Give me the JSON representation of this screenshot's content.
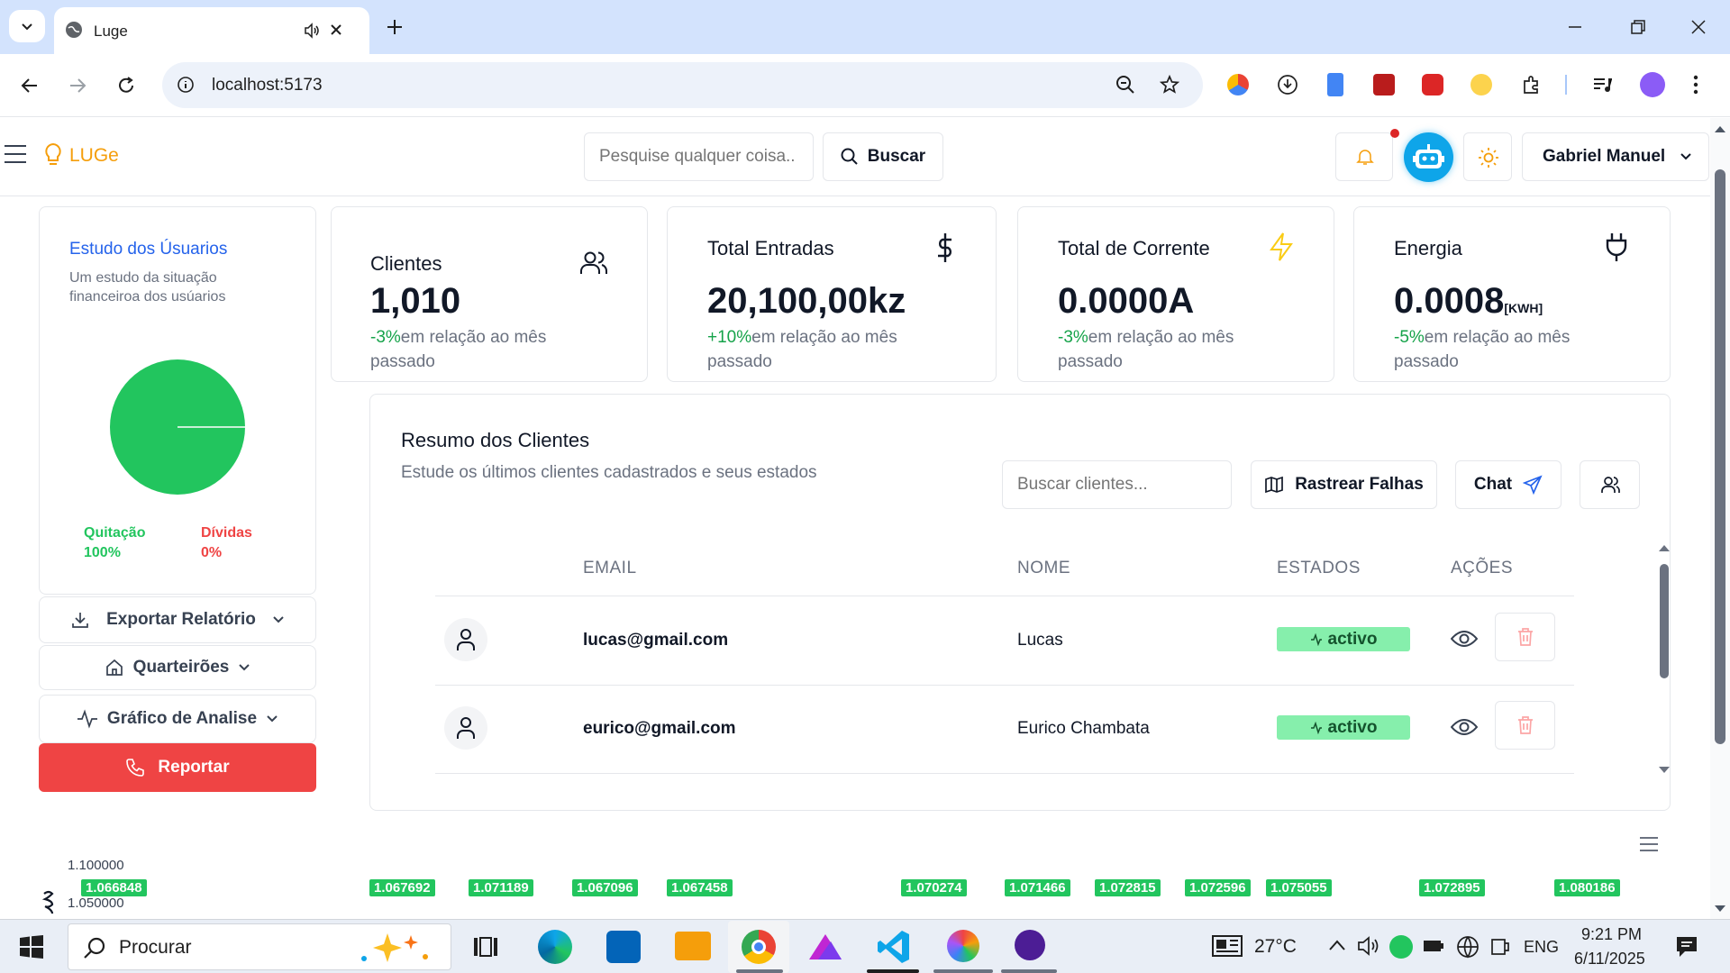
{
  "browser": {
    "tab_title": "Luge",
    "url": "localhost:5173"
  },
  "header": {
    "logo": "LUGe",
    "search_placeholder": "Pesquise qualquer coisa..",
    "search_button": "Buscar",
    "user_name": "Gabriel Manuel"
  },
  "sidebar": {
    "study_title": "Estudo dos Úsuarios",
    "study_subtitle_1": "Um estudo da situação",
    "study_subtitle_2": "financeiroa dos usúarios",
    "legend": [
      {
        "label": "Quitação",
        "value": "100%",
        "color": "#22c55e"
      },
      {
        "label": "Dívidas",
        "value": "0%",
        "color": "#ef4444"
      }
    ],
    "export_label": "Exportar Relatório",
    "blocks_label": "Quarteirões",
    "chart_label": "Gráfico de Analise",
    "report_label": "Reportar"
  },
  "stats": [
    {
      "title": "Clientes",
      "value": "1,010",
      "change": "-3%",
      "note_a": "em relação ao mês",
      "note_b": "passado",
      "icon": "users-icon"
    },
    {
      "title": "Total Entradas",
      "value": "20,100,00kz",
      "change": "+10%",
      "note_a": "em relação ao mês",
      "note_b": "passado",
      "icon": "dollar-icon"
    },
    {
      "title": "Total de Corrente",
      "value": "0.0000A",
      "change": "-3%",
      "note_a": "em relação ao mês",
      "note_b": "passado",
      "icon": "lightning-icon"
    },
    {
      "title": "Energia",
      "value": "0.0008",
      "unit": "[KWH]",
      "change": "-5%",
      "note_a": "em relação ao mês",
      "note_b": "passado",
      "icon": "plug-icon"
    }
  ],
  "clients": {
    "title": "Resumo dos Clientes",
    "subtitle": "Estude os últimos clientes cadastrados e seus estados",
    "search_placeholder": "Buscar clientes...",
    "track_button": "Rastrear Falhas",
    "chat_button": "Chat",
    "columns": [
      "EMAIL",
      "NOME",
      "ESTADOS",
      "AÇÕES"
    ],
    "rows": [
      {
        "email": "lucas@gmail.com",
        "name": "Lucas",
        "status": "activo"
      },
      {
        "email": "eurico@gmail.com",
        "name": "Eurico Chambata",
        "status": "activo"
      }
    ]
  },
  "chart_data": {
    "type": "area",
    "y_ticks": [
      "1.100000",
      "1.050000"
    ],
    "ylim": [
      1.04,
      1.1
    ],
    "labels": [
      "1.066848",
      "1.067692",
      "1.071189",
      "1.067096",
      "1.067458",
      "1.070274",
      "1.071466",
      "1.072815",
      "1.072596",
      "1.075055",
      "1.072895",
      "1.080186"
    ],
    "values": [
      1.066848,
      1.067692,
      1.071189,
      1.067096,
      1.067458,
      1.070274,
      1.071466,
      1.072815,
      1.072596,
      1.075055,
      1.072895,
      1.080186
    ],
    "color": "#22c55e"
  },
  "taskbar": {
    "search_label": "Procurar",
    "temperature": "27°C",
    "language": "ENG",
    "time": "9:21 PM",
    "date": "6/11/2025"
  }
}
